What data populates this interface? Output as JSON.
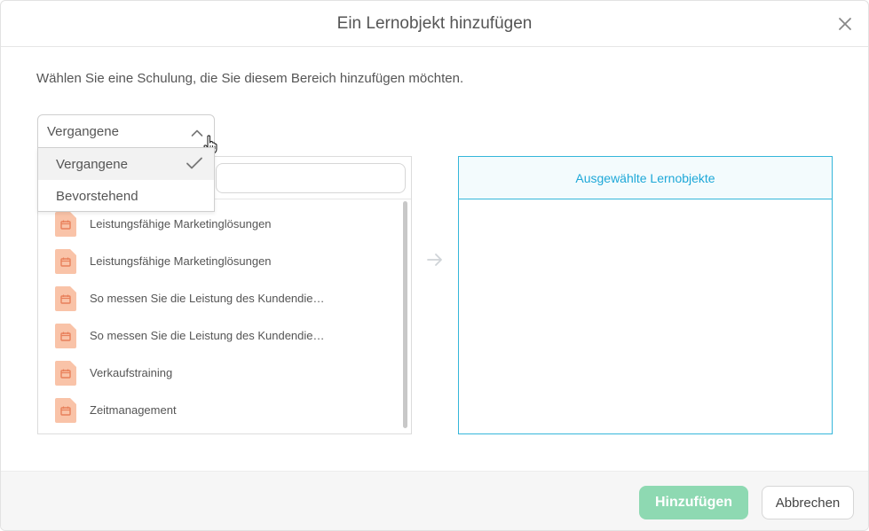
{
  "dialog": {
    "title": "Ein Lernobjekt hinzufügen",
    "instruction": "Wählen Sie eine Schulung, die Sie diesem Bereich hinzufügen möchten."
  },
  "filter": {
    "selected": "Vergangene",
    "options": [
      {
        "label": "Vergangene",
        "selected": true
      },
      {
        "label": "Bevorstehend",
        "selected": false
      }
    ]
  },
  "list": {
    "items": [
      {
        "label": "Leistungsfähige Marketinglösungen",
        "icon": "calendar-file-icon"
      },
      {
        "label": "Leistungsfähige Marketinglösungen",
        "icon": "calendar-file-icon"
      },
      {
        "label": "So messen Sie die Leistung des Kundendie…",
        "icon": "calendar-file-icon"
      },
      {
        "label": "So messen Sie die Leistung des Kundendie…",
        "icon": "calendar-file-icon"
      },
      {
        "label": "Verkaufstraining",
        "icon": "calendar-file-icon"
      },
      {
        "label": "Zeitmanagement",
        "icon": "calendar-file-icon"
      }
    ]
  },
  "selected_panel": {
    "title": "Ausgewählte Lernobjekte"
  },
  "footer": {
    "add_label": "Hinzufügen",
    "cancel_label": "Abbrechen"
  },
  "colors": {
    "accent": "#35b6da",
    "primary_button": "#8ed9b2",
    "file_icon": "#f9c3a8"
  }
}
